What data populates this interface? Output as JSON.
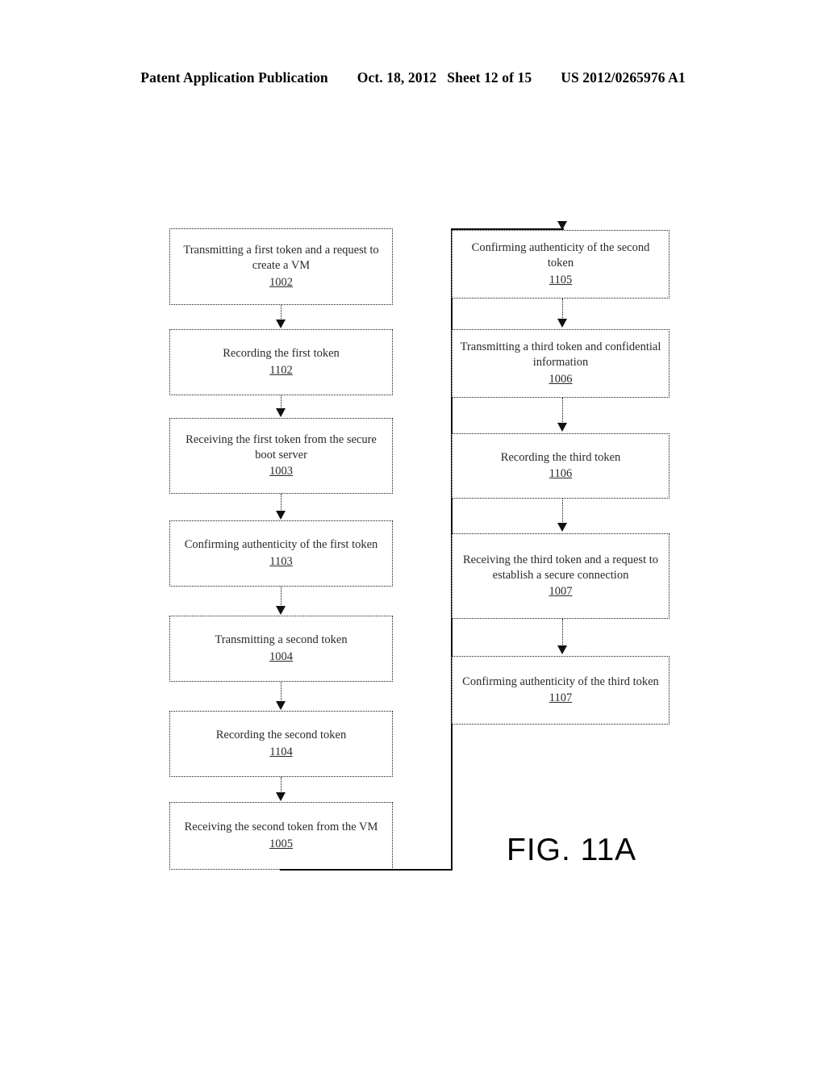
{
  "header": {
    "publication": "Patent Application Publication",
    "date": "Oct. 18, 2012",
    "sheet": "Sheet 12 of 15",
    "patent_number": "US 2012/0265976 A1"
  },
  "figure": {
    "label": "FIG. 11A"
  },
  "flowchart": {
    "left_column": [
      {
        "text": "Transmitting a first token and a request to create a VM",
        "ref": "1002"
      },
      {
        "text": "Recording the first token",
        "ref": "1102"
      },
      {
        "text": "Receiving the first token from the secure boot server",
        "ref": "1003"
      },
      {
        "text": "Confirming authenticity of the first token",
        "ref": "1103"
      },
      {
        "text": "Transmitting a second token",
        "ref": "1004"
      },
      {
        "text": "Recording the second token",
        "ref": "1104"
      },
      {
        "text": "Receiving the second token from the VM",
        "ref": "1005"
      }
    ],
    "right_column": [
      {
        "text": "Confirming authenticity of the second token",
        "ref": "1105"
      },
      {
        "text": "Transmitting a third token and confidential information",
        "ref": "1006"
      },
      {
        "text": "Recording the third token",
        "ref": "1106"
      },
      {
        "text": "Receiving the third token and a request to establish a secure connection",
        "ref": "1007"
      },
      {
        "text": "Confirming authenticity of the third token",
        "ref": "1107"
      }
    ]
  },
  "colors": {
    "ink": "#000000",
    "box_border": "#1a1a1a",
    "page_background": "#ffffff"
  }
}
